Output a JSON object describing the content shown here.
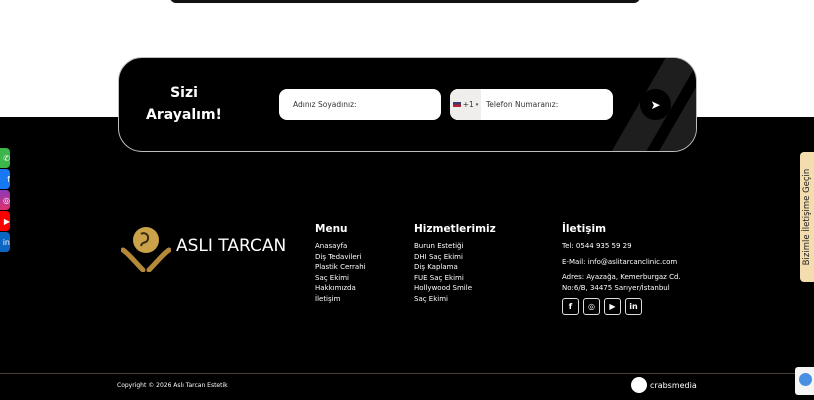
{
  "cta": {
    "title_line1": "Sizi",
    "title_line2": "Arayalım!",
    "name_placeholder": "Adınız Soyadınız:",
    "phone_code": "+1",
    "phone_placeholder": "Telefon Numaranız:",
    "send_icon": "paper-plane-icon"
  },
  "brand": {
    "name": "ASLI TARCAN",
    "logo_color": "#c9a24a"
  },
  "menu": {
    "title": "Menu",
    "items": [
      "Anasayfa",
      "Diş Tedavileri",
      "Plastik Cerrahi",
      "Saç Ekimi",
      "Hakkımızda",
      "İletişim"
    ]
  },
  "services": {
    "title": "Hizmetlerimiz",
    "items": [
      "Burun Estetiği",
      "DHI Saç Ekimi",
      "Diş Kaplama",
      "FUE Saç Ekimi",
      "Hollywood Smile",
      "Saç Ekimi"
    ]
  },
  "contact": {
    "title": "İletişim",
    "phone": "Tel: 0544 935 59 29",
    "email": "E-Mail: info@aslitarcanclinic.com",
    "address1": "Adres: Ayazağa, Kemerburgaz Cd.",
    "address2": "No:6/B, 34475 Sarıyer/İstanbul",
    "social": [
      "f",
      "◎",
      "▶",
      "in"
    ]
  },
  "side_tab": {
    "label": "Bizimle İletişime Geçin",
    "color": "#f3dcae"
  },
  "floating_social": [
    {
      "icon": "whatsapp-icon",
      "glyph": "✆",
      "color": "#3cb54a"
    },
    {
      "icon": "facebook-icon",
      "glyph": "f",
      "color": "#1877f2"
    },
    {
      "icon": "instagram-icon",
      "glyph": "◎",
      "color": "#c13584"
    },
    {
      "icon": "youtube-icon",
      "glyph": "▶",
      "color": "#ff0000"
    },
    {
      "icon": "linkedin-icon",
      "glyph": "in",
      "color": "#0a66c2"
    }
  ],
  "bottom": {
    "copyright": "Copyright © 2026 Aslı Tarcan Estetik",
    "agency": "crabsmedia"
  }
}
